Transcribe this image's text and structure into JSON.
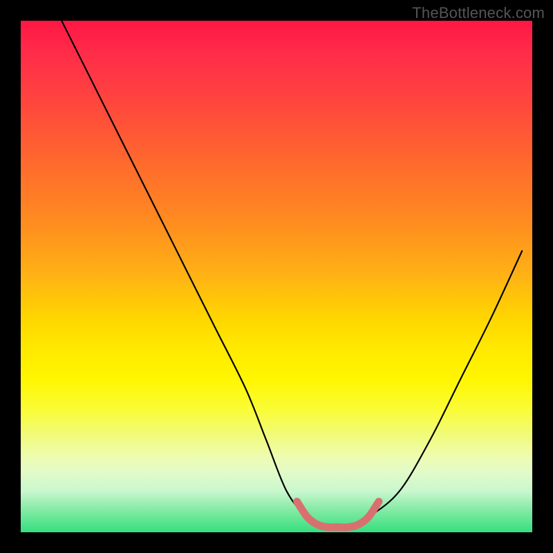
{
  "watermark": "TheBottleneck.com",
  "chart_data": {
    "type": "line",
    "title": "",
    "xlabel": "",
    "ylabel": "",
    "xlim": [
      0,
      100
    ],
    "ylim": [
      0,
      100
    ],
    "grid": false,
    "legend": false,
    "annotations": [],
    "series": [
      {
        "name": "bottleneck-curve",
        "color": "#000000",
        "x": [
          8,
          14,
          20,
          26,
          32,
          38,
          44,
          48,
          52,
          56,
          60,
          64,
          68,
          74,
          80,
          86,
          92,
          98
        ],
        "y": [
          100,
          88,
          76,
          64,
          52,
          40,
          28,
          18,
          8,
          3,
          1,
          1,
          3,
          8,
          18,
          30,
          42,
          55
        ]
      },
      {
        "name": "optimal-range-marker",
        "color": "#e06666",
        "x": [
          54,
          56,
          58,
          60,
          62,
          64,
          66,
          68,
          70
        ],
        "y": [
          6,
          3,
          1.5,
          1,
          1,
          1,
          1.5,
          3,
          6
        ]
      }
    ],
    "gradient_bands": [
      {
        "stop": 0,
        "color": "#ff1744"
      },
      {
        "stop": 0.5,
        "color": "#ffd500"
      },
      {
        "stop": 0.82,
        "color": "#fff95f"
      },
      {
        "stop": 1.0,
        "color": "#35df7f"
      }
    ]
  }
}
